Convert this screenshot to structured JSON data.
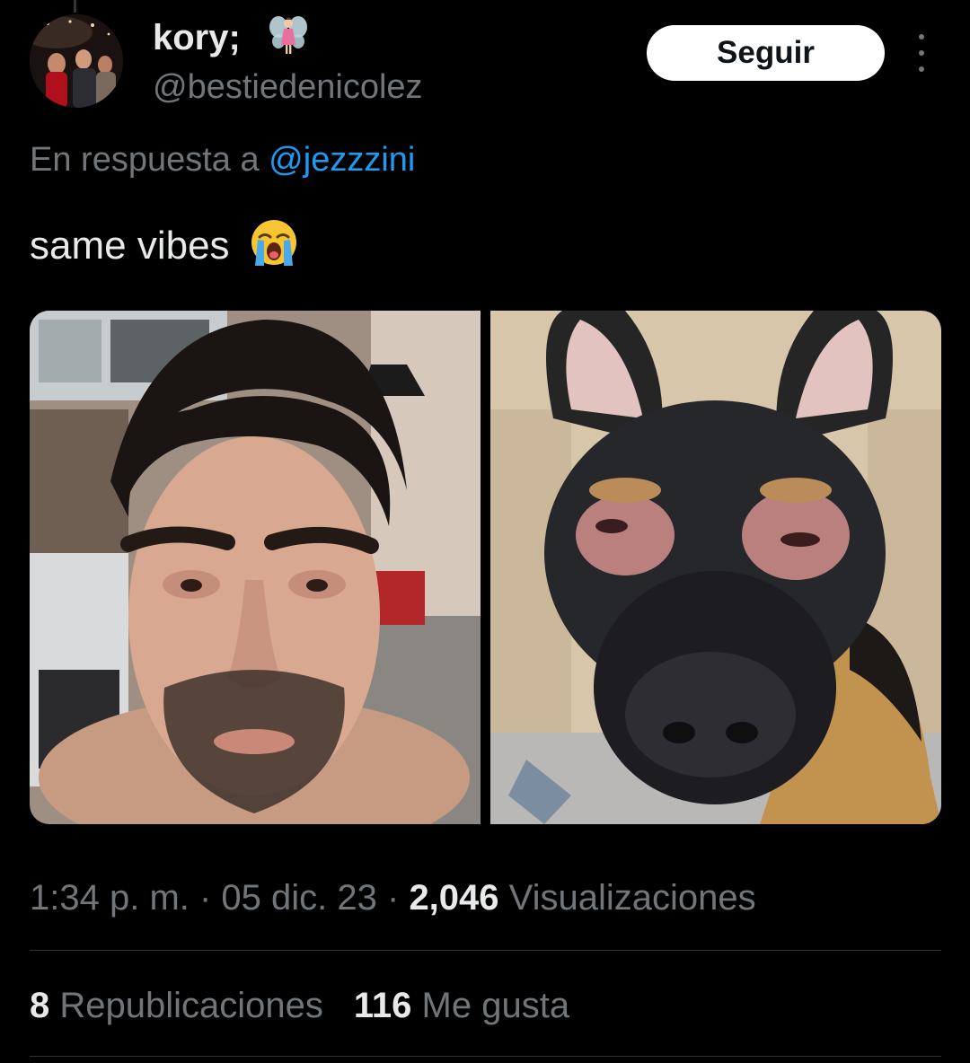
{
  "user": {
    "display_name": "kory;",
    "display_name_emoji": "fairy-icon",
    "handle": "@bestiedenicolez"
  },
  "follow_label": "Seguir",
  "reply": {
    "prefix": "En respuesta a ",
    "mention": "@jezzzini"
  },
  "tweet": {
    "text": "same vibes",
    "emoji": "loudly-crying-face-icon"
  },
  "meta": {
    "time": "1:34 p. m.",
    "separator": " · ",
    "date": "05 dic. 23",
    "views_count": "2,046",
    "views_label": " Visualizaciones"
  },
  "stats": {
    "reposts_count": "8",
    "reposts_label": " Republicaciones",
    "likes_count": "116",
    "likes_label": " Me gusta"
  },
  "colors": {
    "background": "#000000",
    "text_primary": "#e7e9ea",
    "text_secondary": "#71767b",
    "link": "#1d9bf0",
    "divider": "#2f3336",
    "button_bg": "#ffffff"
  }
}
